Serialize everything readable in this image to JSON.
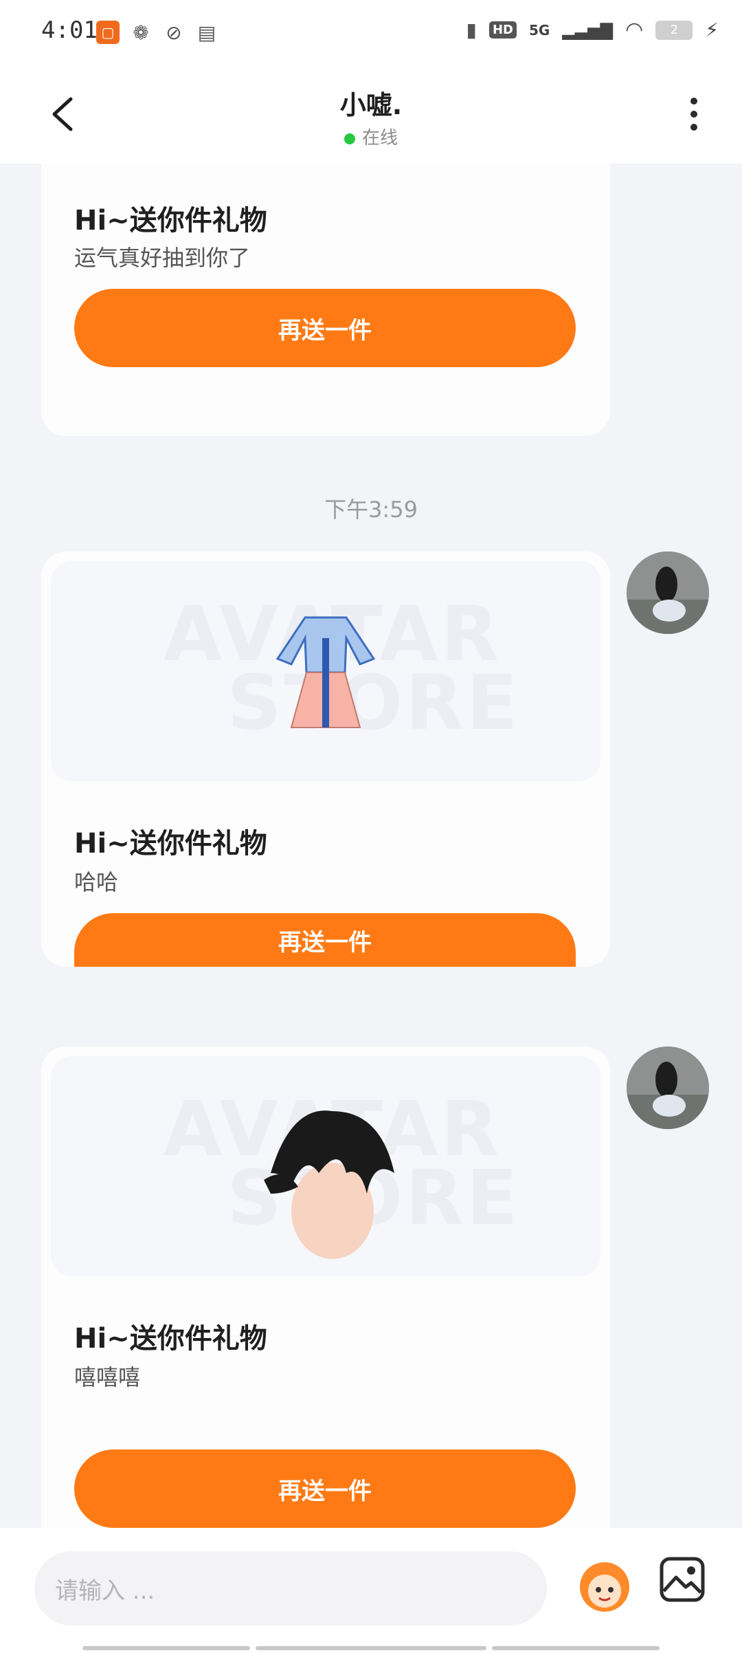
{
  "status_bar": {
    "time": "4:01",
    "network": "5G",
    "hd_badge": "HD",
    "battery": "2",
    "icons": [
      "app-icon",
      "wechat-icon",
      "leaf-icon",
      "card-icon",
      "vibrate-icon",
      "wifi-icon",
      "charging-icon"
    ]
  },
  "header": {
    "title": "小嘘.",
    "status": "在线"
  },
  "messages": [
    {
      "title": "Hi~送你件礼物",
      "text": "运气真好抽到你了",
      "button": "再送一件"
    },
    {
      "title": "Hi~送你件礼物",
      "text": "哈哈",
      "button": "再送一件",
      "watermark": [
        "AVATAR",
        "STORE"
      ],
      "gift_item": "hanfu-dress"
    },
    {
      "title": "Hi~送你件礼物",
      "text": "嘻嘻嘻",
      "button": "再送一件",
      "watermark": [
        "AVATAR",
        "STORE"
      ],
      "gift_item": "hair"
    }
  ],
  "timestamp": "下午3:59",
  "input": {
    "placeholder": "请输入 ..."
  },
  "colors": {
    "accent": "#ff7a14",
    "online": "#27c93f",
    "background": "#f3f4f8"
  }
}
